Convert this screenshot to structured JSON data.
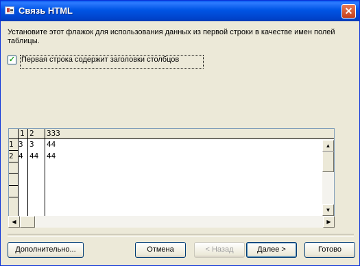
{
  "title_bar": {
    "title": "Связь HTML",
    "close_symbol": "✕"
  },
  "instruction_text": "Установите этот флажок для использования данных из первой строки в качестве имен полей таблицы.",
  "header_checkbox": {
    "checked": true,
    "check_symbol": "✓",
    "label": "Первая строка содержит заголовки столбцов"
  },
  "grid": {
    "headers": [
      "1",
      "2",
      "333"
    ],
    "rows": [
      {
        "num": "1",
        "cells": [
          "3",
          "3",
          "44"
        ]
      },
      {
        "num": "2",
        "cells": [
          "4",
          "44",
          "44"
        ]
      }
    ]
  },
  "buttons": {
    "advanced": "Дополнительно...",
    "cancel": "Отмена",
    "back": "< Назад",
    "next": "Далее >",
    "finish": "Готово"
  },
  "colors": {
    "title_bar": "#0055e5",
    "window_bg": "#ece9d8",
    "close_button": "#c5401c"
  }
}
